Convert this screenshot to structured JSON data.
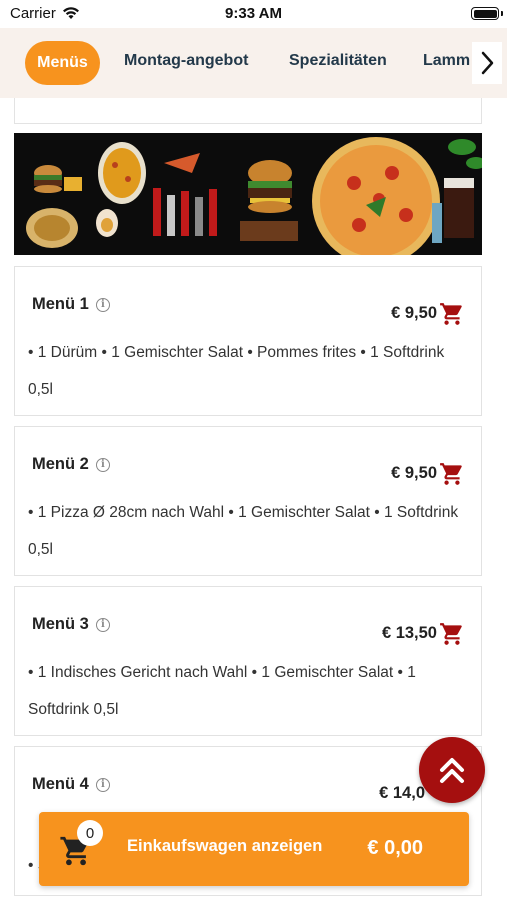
{
  "status_bar": {
    "carrier": "Carrier",
    "time": "9:33 AM"
  },
  "categories": {
    "active": "Menüs",
    "items": [
      "Montag-angebot",
      "Spezialitäten",
      "Lamm"
    ]
  },
  "menus": [
    {
      "title": "Menü 1",
      "price": "€ 9,50",
      "description": "• 1 Dürüm • 1 Gemischter Salat • Pommes frites • 1 Softdrink 0,5l"
    },
    {
      "title": "Menü 2",
      "price": "€ 9,50",
      "description": "• 1 Pizza Ø 28cm nach Wahl • 1 Gemischter Salat • 1 Softdrink 0,5l"
    },
    {
      "title": "Menü 3",
      "price": "€ 13,50",
      "description": "• 1 Indisches Gericht nach Wahl • 1 Gemischter Salat • 1 Softdrink 0,5l"
    },
    {
      "title": "Menü 4",
      "price": "€ 14,0",
      "description": "• S"
    }
  ],
  "cart": {
    "count": "0",
    "label": "Einkaufswagen anzeigen",
    "total": "€ 0,00"
  },
  "colors": {
    "accent": "#f7931e",
    "cart_icon": "#a50f0f",
    "fab": "#a50f0f",
    "nav_text": "#23394a"
  },
  "icons": {
    "info": "info-icon",
    "cart": "cart-icon",
    "scroll_top": "double-chevron-up-icon",
    "next": "chevron-right-icon"
  }
}
